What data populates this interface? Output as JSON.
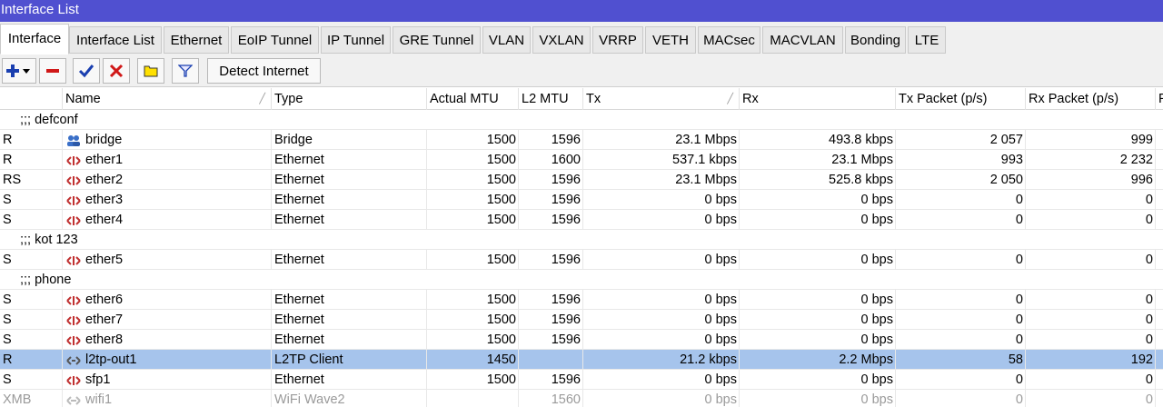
{
  "window": {
    "title": "Interface List"
  },
  "tabs": [
    {
      "label": "Interface",
      "active": true
    },
    {
      "label": "Interface List"
    },
    {
      "label": "Ethernet"
    },
    {
      "label": "EoIP Tunnel"
    },
    {
      "label": "IP Tunnel"
    },
    {
      "label": "GRE Tunnel"
    },
    {
      "label": "VLAN"
    },
    {
      "label": "VXLAN"
    },
    {
      "label": "VRRP"
    },
    {
      "label": "VETH"
    },
    {
      "label": "MACsec"
    },
    {
      "label": "MACVLAN"
    },
    {
      "label": "Bonding"
    },
    {
      "label": "LTE"
    }
  ],
  "toolbar": {
    "detect_label": "Detect Internet",
    "icons": [
      "add-icon",
      "remove-icon",
      "enable-check-icon",
      "disable-x-icon",
      "comment-icon",
      "filter-icon"
    ]
  },
  "columns": {
    "flags": "",
    "name": "Name",
    "type": "Type",
    "mtu": "Actual MTU",
    "l2mtu": "L2 MTU",
    "tx": "Tx",
    "rx": "Rx",
    "txp": "Tx Packet (p/s)",
    "rxp": "Rx Packet (p/s)",
    "more": "F"
  },
  "rows": [
    {
      "comment": ";;; defconf"
    },
    {
      "flags": "R",
      "icon": "bridge-icon",
      "name": "bridge",
      "type": "Bridge",
      "mtu": "1500",
      "l2mtu": "1596",
      "tx": "23.1 Mbps",
      "rx": "493.8 kbps",
      "txp": "2 057",
      "rxp": "999"
    },
    {
      "flags": "R",
      "icon": "ethernet-icon",
      "name": "ether1",
      "type": "Ethernet",
      "mtu": "1500",
      "l2mtu": "1600",
      "tx": "537.1 kbps",
      "rx": "23.1 Mbps",
      "txp": "993",
      "rxp": "2 232"
    },
    {
      "flags": "RS",
      "icon": "ethernet-icon",
      "name": "ether2",
      "type": "Ethernet",
      "mtu": "1500",
      "l2mtu": "1596",
      "tx": "23.1 Mbps",
      "rx": "525.8 kbps",
      "txp": "2 050",
      "rxp": "996"
    },
    {
      "flags": "S",
      "icon": "ethernet-icon",
      "name": "ether3",
      "type": "Ethernet",
      "mtu": "1500",
      "l2mtu": "1596",
      "tx": "0 bps",
      "rx": "0 bps",
      "txp": "0",
      "rxp": "0"
    },
    {
      "flags": "S",
      "icon": "ethernet-icon",
      "name": "ether4",
      "type": "Ethernet",
      "mtu": "1500",
      "l2mtu": "1596",
      "tx": "0 bps",
      "rx": "0 bps",
      "txp": "0",
      "rxp": "0"
    },
    {
      "comment": ";;; kot 123"
    },
    {
      "flags": "S",
      "icon": "ethernet-icon",
      "name": "ether5",
      "type": "Ethernet",
      "mtu": "1500",
      "l2mtu": "1596",
      "tx": "0 bps",
      "rx": "0 bps",
      "txp": "0",
      "rxp": "0"
    },
    {
      "comment": ";;; phone"
    },
    {
      "flags": "S",
      "icon": "ethernet-icon",
      "name": "ether6",
      "type": "Ethernet",
      "mtu": "1500",
      "l2mtu": "1596",
      "tx": "0 bps",
      "rx": "0 bps",
      "txp": "0",
      "rxp": "0"
    },
    {
      "flags": "S",
      "icon": "ethernet-icon",
      "name": "ether7",
      "type": "Ethernet",
      "mtu": "1500",
      "l2mtu": "1596",
      "tx": "0 bps",
      "rx": "0 bps",
      "txp": "0",
      "rxp": "0"
    },
    {
      "flags": "S",
      "icon": "ethernet-icon",
      "name": "ether8",
      "type": "Ethernet",
      "mtu": "1500",
      "l2mtu": "1596",
      "tx": "0 bps",
      "rx": "0 bps",
      "txp": "0",
      "rxp": "0"
    },
    {
      "flags": "R",
      "icon": "tunnel-icon",
      "name": "l2tp-out1",
      "type": "L2TP Client",
      "mtu": "1450",
      "l2mtu": "",
      "tx": "21.2 kbps",
      "rx": "2.2 Mbps",
      "txp": "58",
      "rxp": "192",
      "selected": true
    },
    {
      "flags": "S",
      "icon": "ethernet-icon",
      "name": "sfp1",
      "type": "Ethernet",
      "mtu": "1500",
      "l2mtu": "1596",
      "tx": "0 bps",
      "rx": "0 bps",
      "txp": "0",
      "rxp": "0"
    },
    {
      "flags": "XMB",
      "icon": "wifi-icon",
      "name": "wifi1",
      "type": "WiFi Wave2",
      "mtu": "",
      "l2mtu": "1560",
      "tx": "0 bps",
      "rx": "0 bps",
      "txp": "0",
      "rxp": "0",
      "disabled": true
    }
  ],
  "colors": {
    "titlebar": "#5050d0",
    "selected_row": "#a6c4ec",
    "ethernet_icon": "#c03030",
    "bridge_icon": "#3a6fc8"
  }
}
